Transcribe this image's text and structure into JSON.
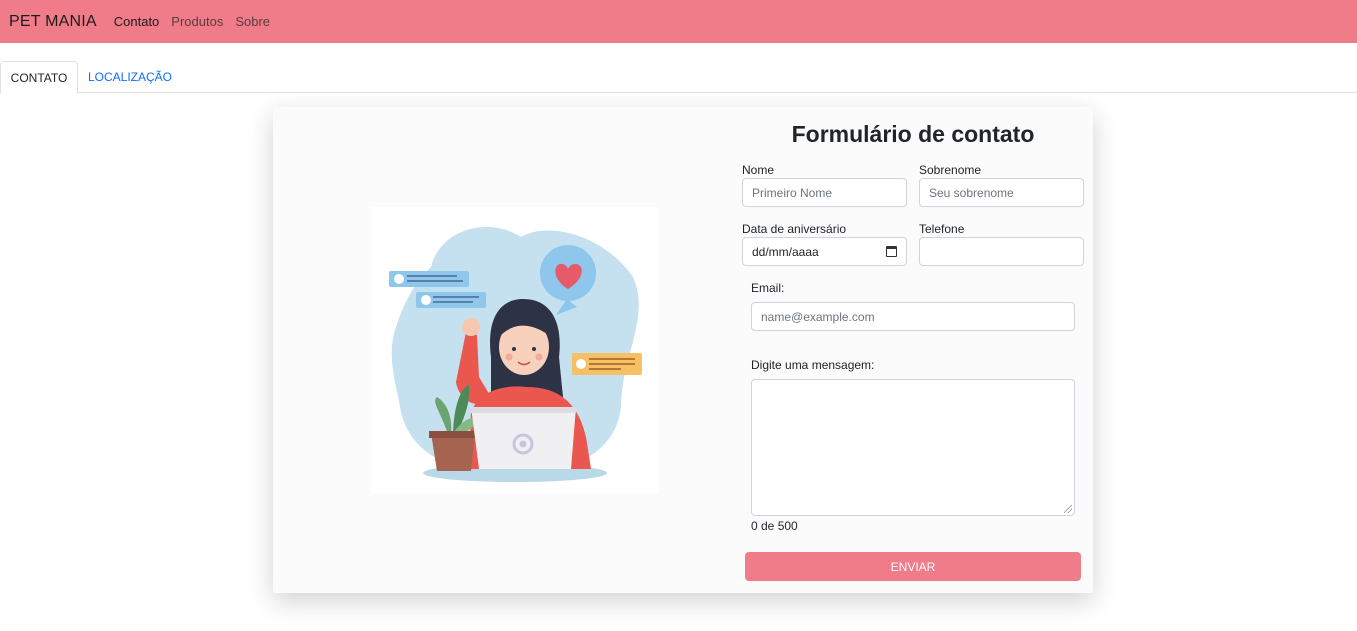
{
  "navbar": {
    "brand": "PET MANIA",
    "links": [
      {
        "label": "Contato",
        "active": true
      },
      {
        "label": "Produtos",
        "active": false
      },
      {
        "label": "Sobre",
        "active": false
      }
    ],
    "color": "#f07b89"
  },
  "tabs": [
    {
      "label": "CONTATO",
      "active": true
    },
    {
      "label": "LOCALIZAÇÃO",
      "active": false
    }
  ],
  "form": {
    "title": "Formulário de contato",
    "nome": {
      "label": "Nome",
      "placeholder": "Primeiro Nome"
    },
    "sobrenome": {
      "label": "Sobrenome",
      "placeholder": "Seu sobrenome"
    },
    "data": {
      "label": "Data de aniversário",
      "value": "dd/mm/aaaa",
      "icon": "calendar-icon"
    },
    "telefone": {
      "label": "Telefone",
      "value": ""
    },
    "email": {
      "label": "Email:",
      "placeholder": "name@example.com"
    },
    "mensagem": {
      "label": "Digite uma mensagem:",
      "value": ""
    },
    "counter": "0 de 500",
    "submit": "ENVIAR"
  },
  "colors": {
    "accent": "#f07b89",
    "link": "#0d6efd",
    "illustration_blob": "#c5e0ee",
    "illustration_shirt": "#e9574f"
  }
}
